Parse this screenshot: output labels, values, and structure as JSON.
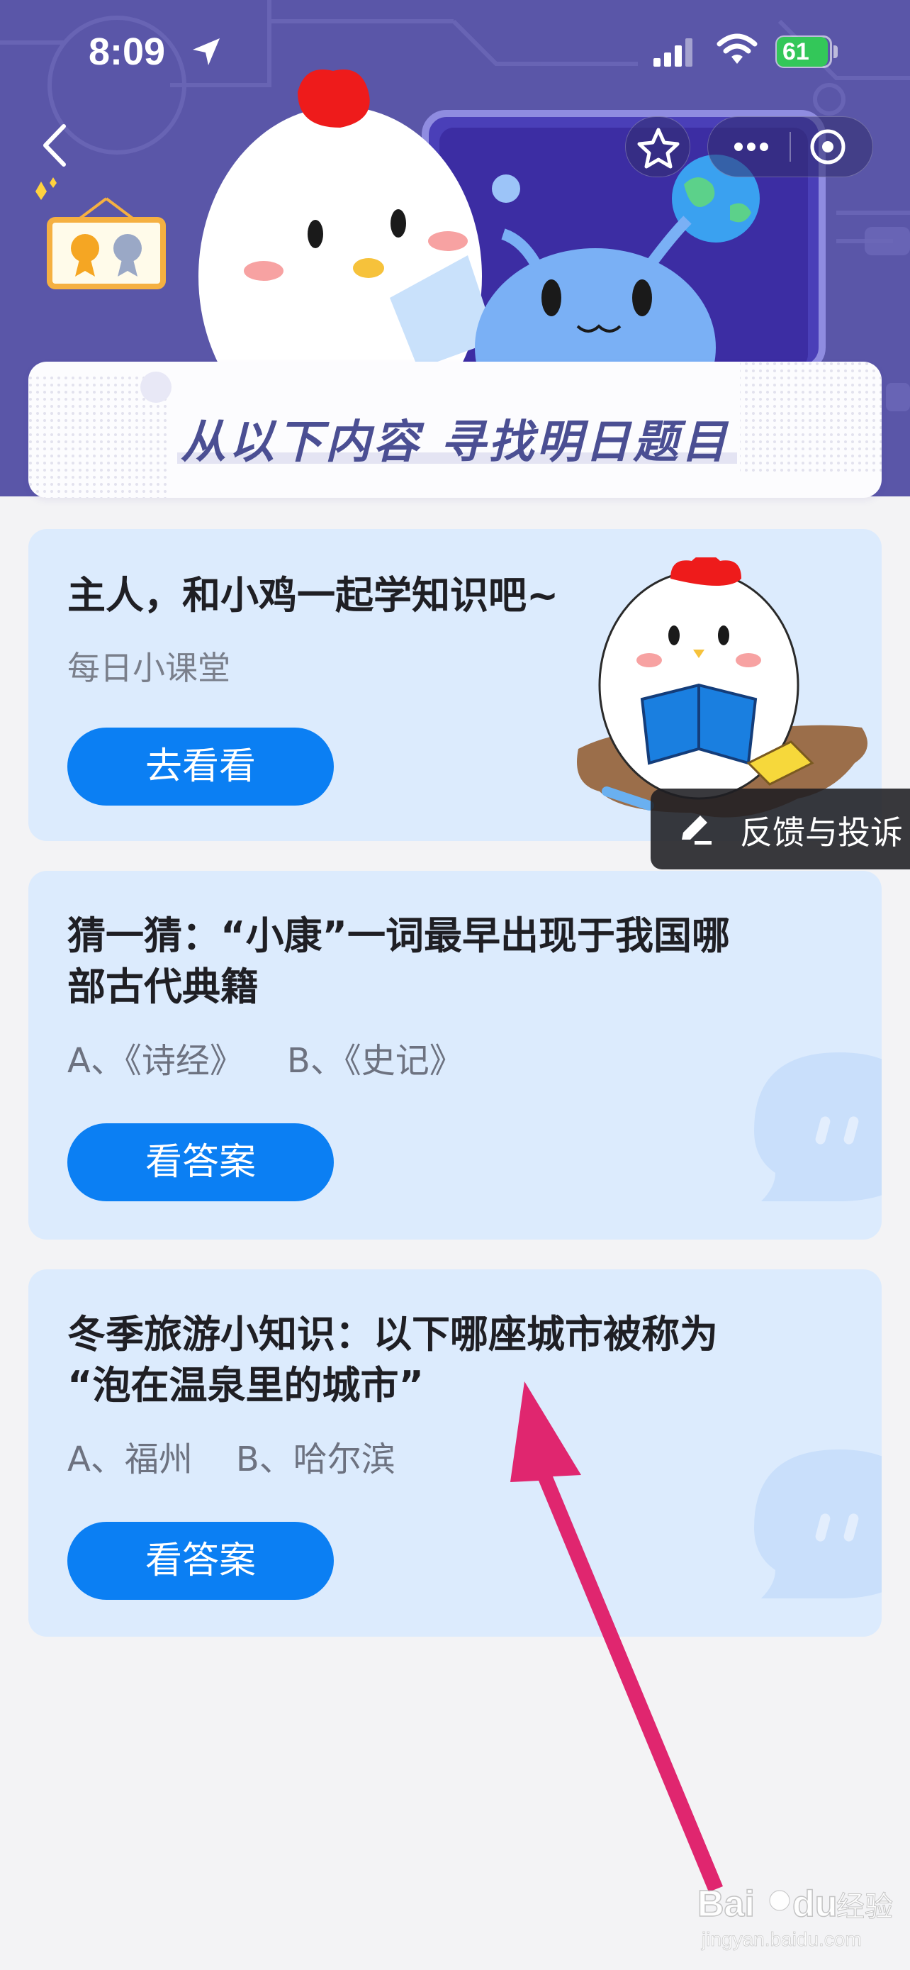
{
  "status_bar": {
    "time": "8:09",
    "battery": "61"
  },
  "banner": {
    "title": "从以下内容  寻找明日题目"
  },
  "cards": [
    {
      "title": "主人，和小鸡一起学知识吧~",
      "subtitle": "每日小课堂",
      "button": "去看看"
    },
    {
      "title_line1": "猜一猜：“小康”一词最早出现于我国哪",
      "title_line2": "部古代典籍",
      "options": "A、《诗经》    B、《史记》",
      "button": "看答案"
    },
    {
      "title_line1": "冬季旅游小知识：以下哪座城市被称为",
      "title_line2": "“泡在温泉里的城市”",
      "options": "A、福州    B、哈尔滨",
      "button": "看答案"
    }
  ],
  "feedback": {
    "label": "反馈与投诉"
  },
  "watermark": {
    "brand": "Bai",
    "brand2": "du",
    "cn": "经验",
    "url": "jingyan.baidu.com"
  },
  "colors": {
    "header_bg": "#5a56a8",
    "card_bg": "#dcebfd",
    "button_blue": "#0b7ff3",
    "arrow": "#e0266f",
    "banner_text": "#4b4f93"
  },
  "icons": [
    "location-arrow-icon",
    "signal-icon",
    "wifi-icon",
    "battery-icon",
    "back-chevron-icon",
    "star-icon",
    "more-dots-icon",
    "close-circle-icon",
    "edit-pencil-icon",
    "chat-bubble-icon"
  ]
}
